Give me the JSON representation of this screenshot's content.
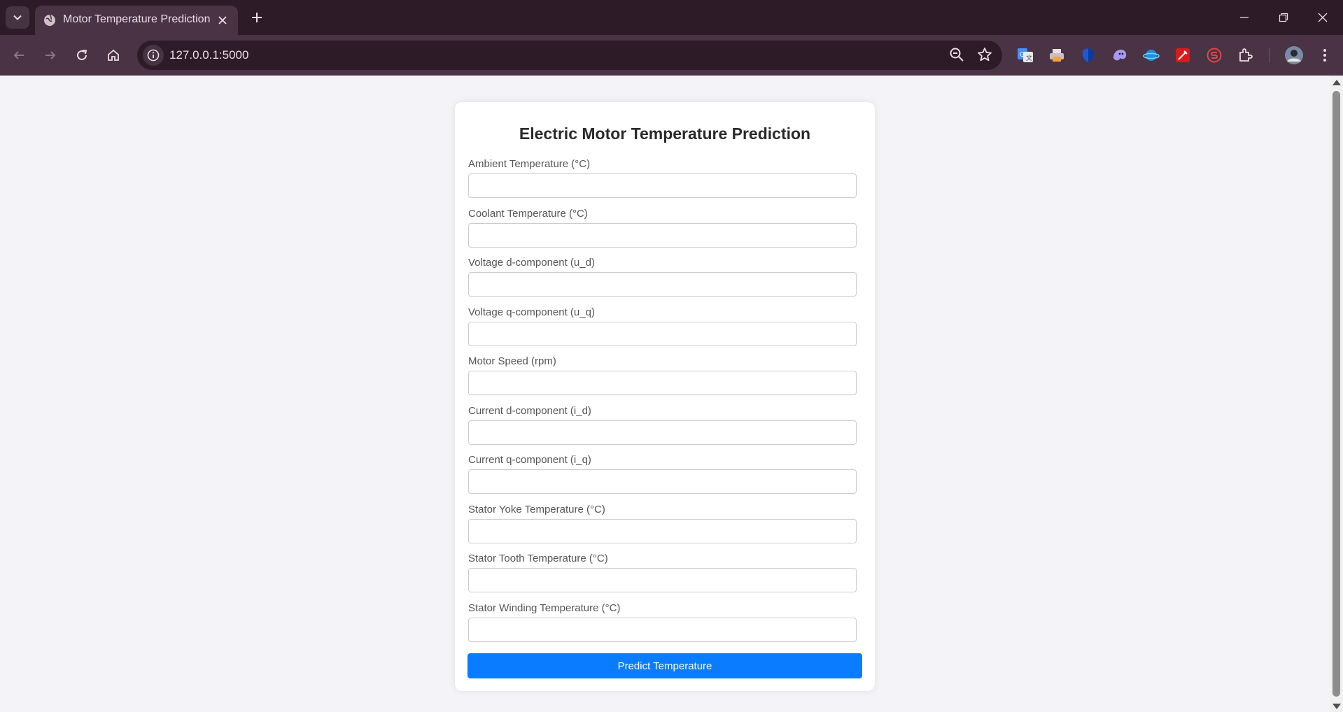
{
  "browser": {
    "tab_title": "Motor Temperature Prediction",
    "url": "127.0.0.1:5000",
    "colors": {
      "frame": "#2d1b27",
      "toolbar": "#4a3344"
    },
    "extensions": [
      "google-translate-icon",
      "printer-icon",
      "shield-icon",
      "ghost-icon",
      "planet-icon",
      "red-pen-icon",
      "red-s-icon",
      "puzzle-extensions-icon"
    ]
  },
  "page": {
    "heading": "Electric Motor Temperature Prediction",
    "fields": [
      {
        "label": "Ambient Temperature (°C)",
        "value": ""
      },
      {
        "label": "Coolant Temperature (°C)",
        "value": ""
      },
      {
        "label": "Voltage d-component (u_d)",
        "value": ""
      },
      {
        "label": "Voltage q-component (u_q)",
        "value": ""
      },
      {
        "label": "Motor Speed (rpm)",
        "value": ""
      },
      {
        "label": "Current d-component (i_d)",
        "value": ""
      },
      {
        "label": "Current q-component (i_q)",
        "value": ""
      },
      {
        "label": "Stator Yoke Temperature (°C)",
        "value": ""
      },
      {
        "label": "Stator Tooth Temperature (°C)",
        "value": ""
      },
      {
        "label": "Stator Winding Temperature (°C)",
        "value": ""
      }
    ],
    "submit_label": "Predict Temperature",
    "colors": {
      "background": "#f3f3f8",
      "button": "#0a7cff"
    }
  }
}
